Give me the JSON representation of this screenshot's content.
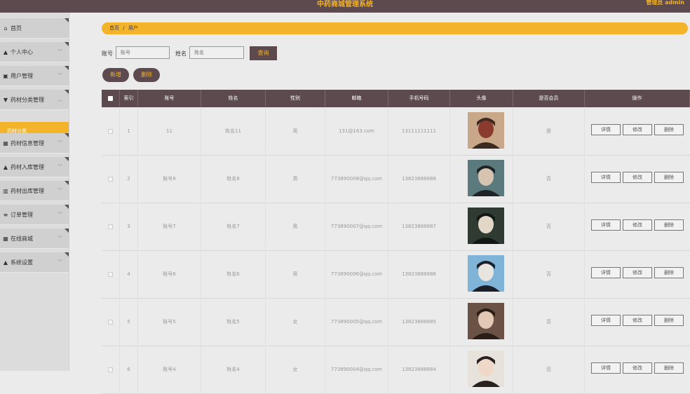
{
  "header": {
    "title": "中药商城管理系统",
    "user": "管理员 admin"
  },
  "sidebar": {
    "items": [
      {
        "label": "首页",
        "icon": "home-icon",
        "glyph": "⌂"
      },
      {
        "label": "个人中心",
        "icon": "user-icon",
        "glyph": "▲"
      },
      {
        "label": "用户管理",
        "icon": "users-icon",
        "glyph": "▣"
      },
      {
        "label": "药材分类管理",
        "icon": "category-icon",
        "glyph": "▼"
      },
      {
        "label": "药材信息管理",
        "icon": "grid-icon",
        "glyph": "▦"
      },
      {
        "label": "药材入库管理",
        "icon": "inbound-icon",
        "glyph": "▲"
      },
      {
        "label": "药材出库管理",
        "icon": "bar-chart-icon",
        "glyph": "▥"
      },
      {
        "label": "订单管理",
        "icon": "list-icon",
        "glyph": "≡"
      },
      {
        "label": "在线商城",
        "icon": "shop-grid-icon",
        "glyph": "▦"
      },
      {
        "label": "系统设置",
        "icon": "settings-user-icon",
        "glyph": "▲"
      }
    ],
    "active_sub": "药材分类"
  },
  "breadcrumb": {
    "home": "首页",
    "sep": "/",
    "current": "用户"
  },
  "search": {
    "account_label": "账号",
    "account_placeholder": "账号",
    "name_label": "姓名",
    "name_placeholder": "姓名",
    "query_button": "查询"
  },
  "actions": {
    "add": "新增",
    "delete": "删除"
  },
  "table": {
    "headers": [
      "索引",
      "账号",
      "姓名",
      "性别",
      "邮箱",
      "手机号码",
      "头像",
      "是否会员",
      "操作"
    ],
    "row_buttons": [
      "详情",
      "修改",
      "删除"
    ],
    "rows": [
      {
        "index": "1",
        "account": "11",
        "name": "姓名11",
        "gender": "男",
        "email": "131@163.com",
        "phone": "13111111111",
        "member": "是",
        "avatar_colors": [
          "#c9a88a",
          "#3a2a22",
          "#8b3a2e"
        ]
      },
      {
        "index": "2",
        "account": "账号8",
        "name": "姓名8",
        "gender": "男",
        "email": "773890008@qq.com",
        "phone": "13823888888",
        "member": "否",
        "avatar_colors": [
          "#5b7a7e",
          "#1e2426",
          "#d6c3b0"
        ]
      },
      {
        "index": "3",
        "account": "账号7",
        "name": "姓名7",
        "gender": "男",
        "email": "773890007@qq.com",
        "phone": "13823888887",
        "member": "否",
        "avatar_colors": [
          "#2f3a33",
          "#121614",
          "#e2d6c6"
        ]
      },
      {
        "index": "4",
        "account": "账号6",
        "name": "姓名6",
        "gender": "男",
        "email": "773890006@qq.com",
        "phone": "13823888886",
        "member": "否",
        "avatar_colors": [
          "#7fb3d8",
          "#1a1f2a",
          "#e8e4e0"
        ]
      },
      {
        "index": "5",
        "account": "账号5",
        "name": "姓名5",
        "gender": "女",
        "email": "773890005@qq.com",
        "phone": "13823888885",
        "member": "否",
        "avatar_colors": [
          "#6a5346",
          "#2b1e18",
          "#e4c8b6"
        ]
      },
      {
        "index": "6",
        "account": "账号4",
        "name": "姓名4",
        "gender": "女",
        "email": "773890004@qq.com",
        "phone": "13823888884",
        "member": "否",
        "avatar_colors": [
          "#e8e2dc",
          "#2a2020",
          "#f0d8c8"
        ]
      }
    ]
  },
  "colors": {
    "primary": "#5d4a4e",
    "accent": "#f3b32a"
  }
}
